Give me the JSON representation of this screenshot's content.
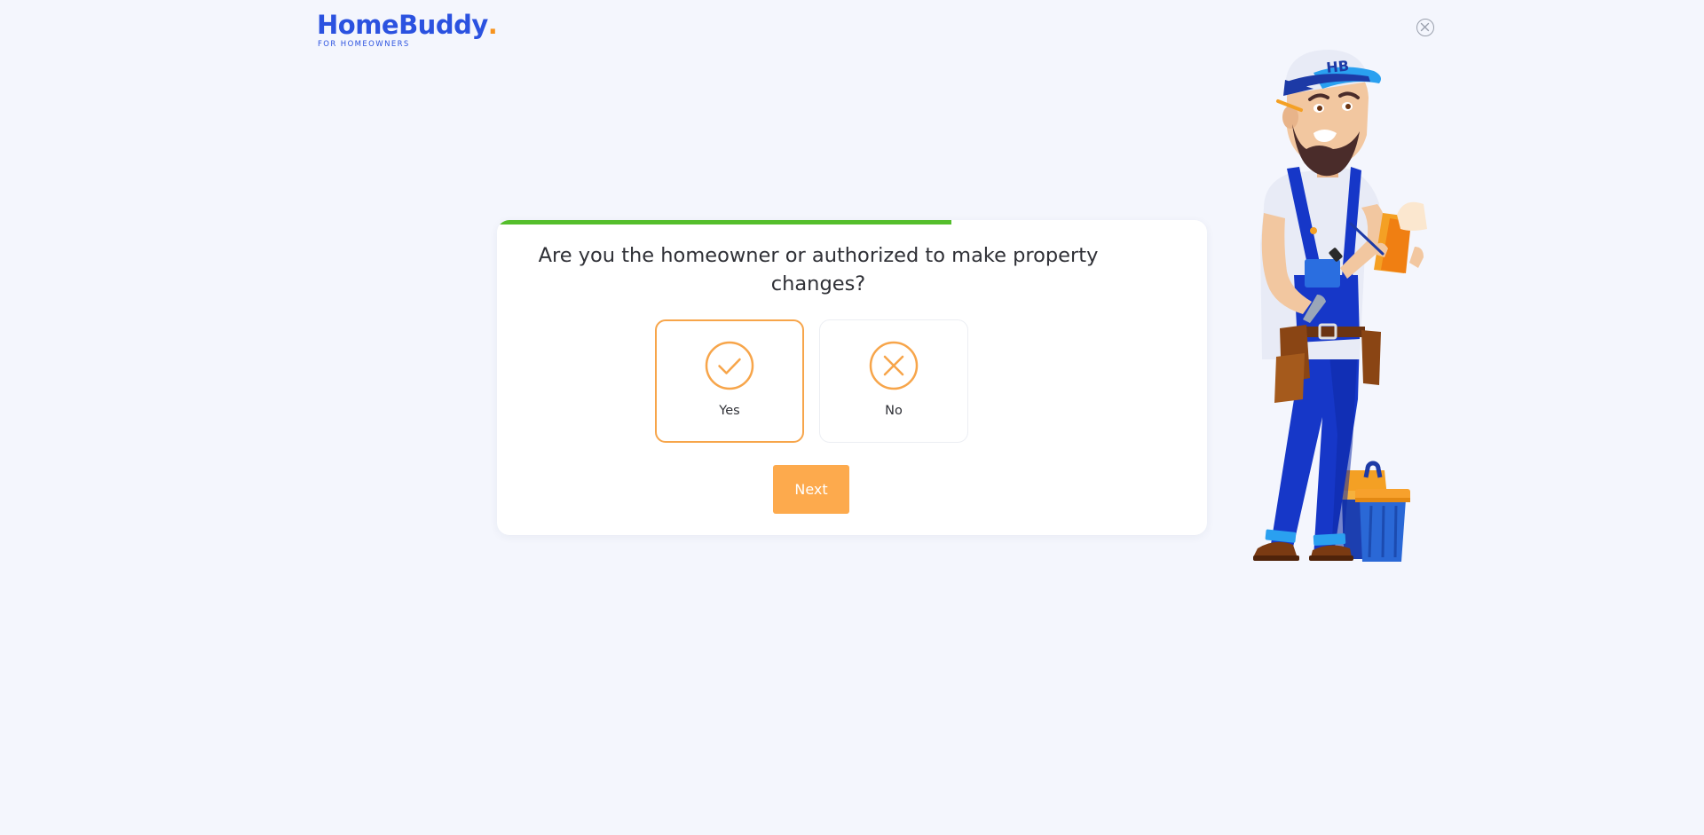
{
  "brand": {
    "name": "HomeBuddy",
    "dot": ".",
    "tagline": "FOR HOMEOWNERS",
    "primary_color": "#2b52e0",
    "accent_color": "#f7931e"
  },
  "close": {
    "icon": "close-icon"
  },
  "progress": {
    "fraction": 0.64,
    "color": "#55be2c"
  },
  "question": {
    "text": "Are you the homeowner or authorized to make property changes?"
  },
  "options": [
    {
      "label": "Yes",
      "icon": "check-icon",
      "selected": true
    },
    {
      "label": "No",
      "icon": "x-icon",
      "selected": false
    }
  ],
  "next_button": {
    "label": "Next",
    "color": "#fdaa4d"
  },
  "illustration": {
    "cap_text": "HB"
  }
}
